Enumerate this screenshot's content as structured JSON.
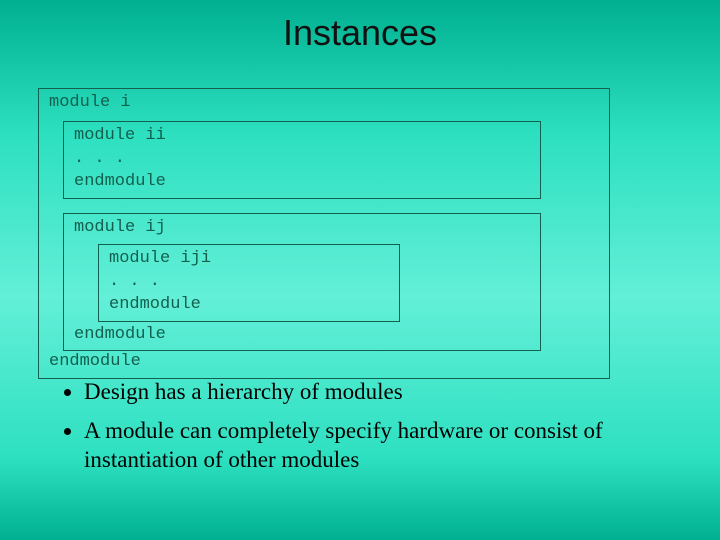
{
  "title": "Instances",
  "diagram": {
    "outer_open": "module i",
    "outer_close": "endmodule",
    "box_ii_open": "module ii",
    "box_ii_body": ". . .",
    "box_ii_close": "endmodule",
    "box_ij_open": "module ij",
    "box_ij_close": "endmodule",
    "box_iji_open": "module iji",
    "box_iji_body": ". . .",
    "box_iji_close": "endmodule"
  },
  "bullets": {
    "b1": "Design has a hierarchy of modules",
    "b2": "A module can completely specify hardware or consist of instantiation of other modules"
  }
}
